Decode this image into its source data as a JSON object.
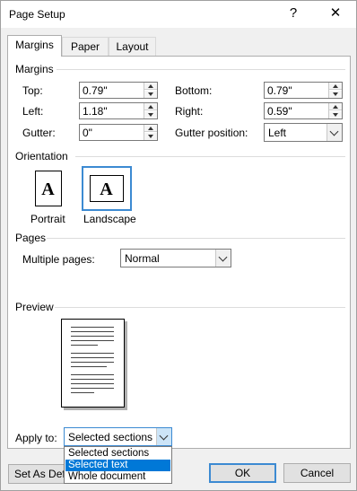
{
  "window": {
    "title": "Page Setup",
    "help_label": "?",
    "close_label": "✕"
  },
  "tabs": [
    {
      "label": "Margins",
      "active": true
    },
    {
      "label": "Paper",
      "active": false
    },
    {
      "label": "Layout",
      "active": false
    }
  ],
  "margins": {
    "group_label": "Margins",
    "top_label": "Top:",
    "top_value": "0.79\"",
    "bottom_label": "Bottom:",
    "bottom_value": "0.79\"",
    "left_label": "Left:",
    "left_value": "1.18\"",
    "right_label": "Right:",
    "right_value": "0.59\"",
    "gutter_label": "Gutter:",
    "gutter_value": "0\"",
    "gutter_position_label": "Gutter position:",
    "gutter_position_value": "Left"
  },
  "orientation": {
    "group_label": "Orientation",
    "portrait_label": "Portrait",
    "landscape_label": "Landscape",
    "icon_letter": "A",
    "selected": "Landscape"
  },
  "pages": {
    "group_label": "Pages",
    "multiple_pages_label": "Multiple pages:",
    "multiple_pages_value": "Normal"
  },
  "preview": {
    "group_label": "Preview"
  },
  "apply_to": {
    "label": "Apply to:",
    "value": "Selected sections",
    "options": [
      "Selected sections",
      "Selected text",
      "Whole document"
    ],
    "highlighted": "Selected text"
  },
  "footer": {
    "set_default_label": "Set As Default",
    "ok_label": "OK",
    "cancel_label": "Cancel"
  },
  "colors": {
    "accent": "#3c8ad2",
    "highlight": "#0078d7"
  }
}
